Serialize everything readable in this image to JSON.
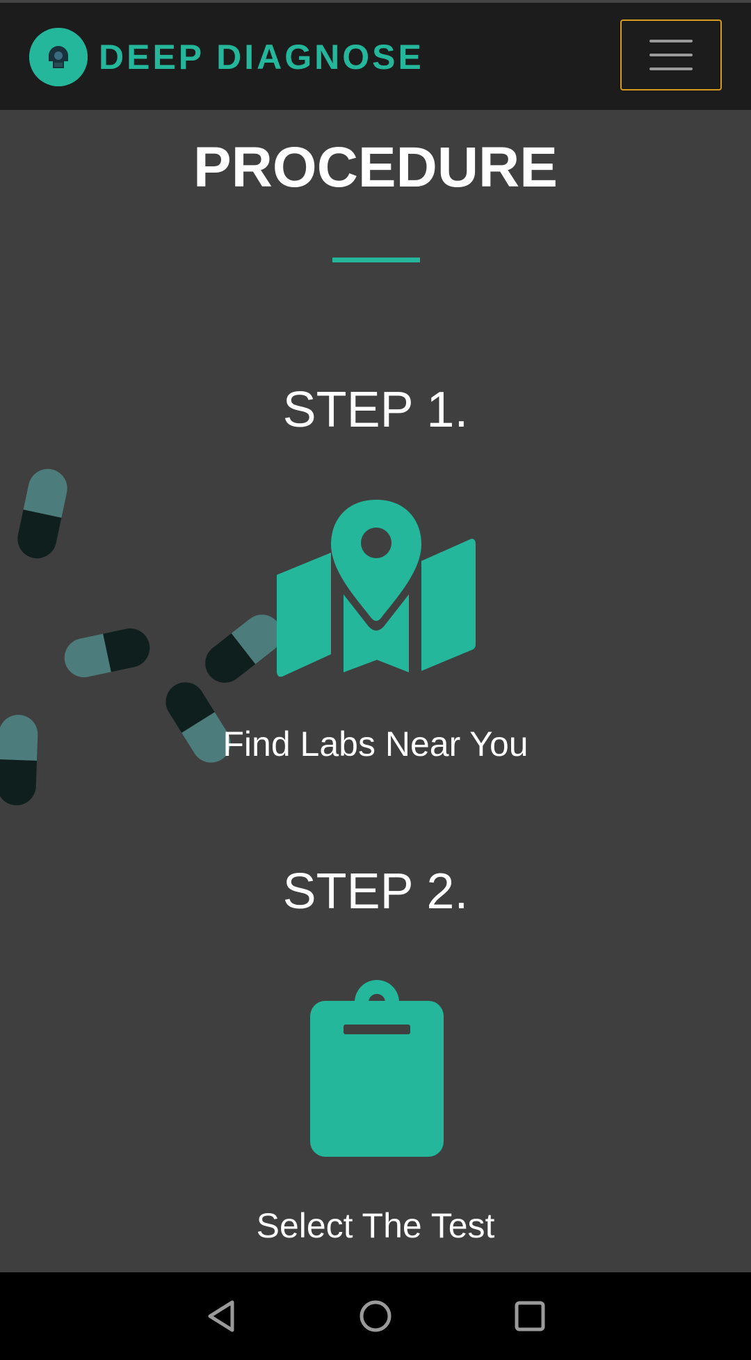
{
  "brand": {
    "name": "DEEP DIAGNOSE",
    "logo_icon": "brain-scan-logo-icon"
  },
  "colors": {
    "accent": "#24b79c",
    "navbar": "#1c1c1c",
    "menu_border": "#d79a1e",
    "background": "#3f3f3f"
  },
  "section": {
    "title": "PROCEDURE"
  },
  "steps": [
    {
      "label": "STEP 1.",
      "icon": "map-marker-icon",
      "text": "Find Labs Near You"
    },
    {
      "label": "STEP 2.",
      "icon": "clipboard-icon",
      "text": "Select The Test"
    }
  ],
  "system_nav": {
    "back": "back-icon",
    "home": "home-icon",
    "recents": "recents-icon"
  }
}
